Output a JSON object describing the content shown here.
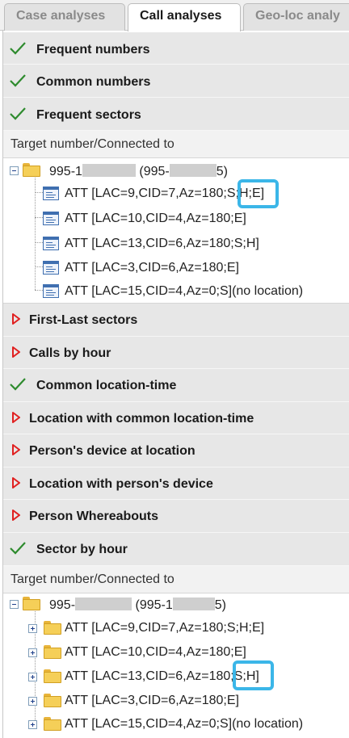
{
  "tabs": [
    {
      "label": "Case analyses"
    },
    {
      "label": "Call analyses"
    },
    {
      "label": "Geo-loc analy"
    }
  ],
  "sections": {
    "frequent_numbers": "Frequent numbers",
    "common_numbers": "Common numbers",
    "frequent_sectors": "Frequent sectors",
    "first_last_sectors": "First-Last sectors",
    "calls_by_hour": "Calls by hour",
    "common_location_time": "Common location-time",
    "location_common_location_time": "Location with common location-time",
    "persons_device_at_location": "Person's device at location",
    "location_with_persons_device": "Location with person's device",
    "person_whereabouts": "Person Whereabouts",
    "sector_by_hour": "Sector by hour"
  },
  "subheader": "Target number/Connected to",
  "tree1": {
    "root_prefix": "995-1",
    "root_mid": "(995-",
    "root_suffix": "5)",
    "items": [
      "ATT [LAC=9,CID=7,Az=180;S;H;E]",
      "ATT [LAC=10,CID=4,Az=180;E]",
      "ATT [LAC=13,CID=6,Az=180;S;H]",
      "ATT [LAC=3,CID=6,Az=180;E]",
      "ATT [LAC=15,CID=4,Az=0;S](no location)"
    ]
  },
  "tree2": {
    "root_prefix": "995-",
    "root_mid": "(995-1",
    "root_suffix": "5)",
    "items": [
      "ATT [LAC=9,CID=7,Az=180;S;H;E]",
      "ATT [LAC=10,CID=4,Az=180;E]",
      "ATT [LAC=13,CID=6,Az=180;S;H]",
      "ATT [LAC=3,CID=6,Az=180;E]",
      "ATT [LAC=15,CID=4,Az=0;S](no location)"
    ]
  },
  "colors": {
    "check": "#2e8b2e",
    "arrow": "#e02020",
    "highlight": "#3bb6e8"
  },
  "icons": {
    "done": "checkmark-icon",
    "collapsed": "right-arrow-icon",
    "folder": "folder-icon",
    "leaf": "list-window-icon"
  }
}
